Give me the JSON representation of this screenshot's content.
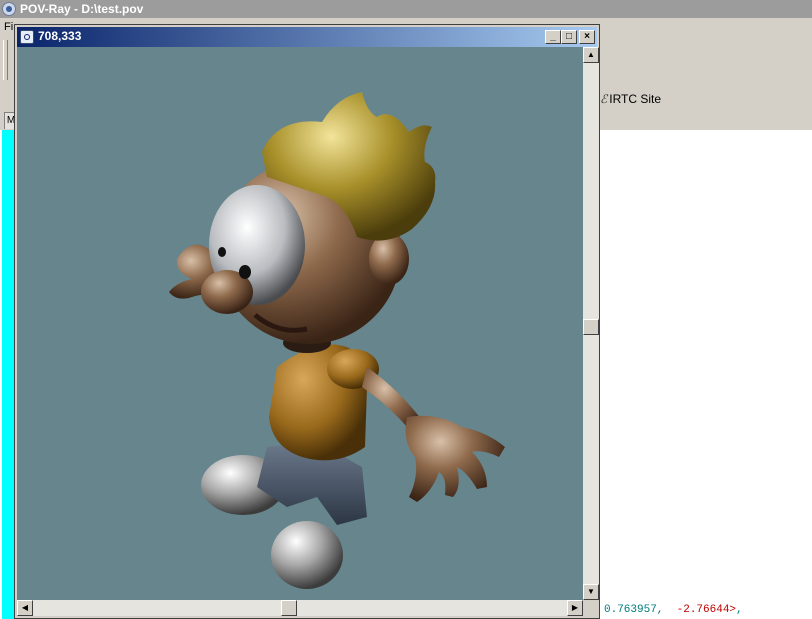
{
  "app": {
    "title": "POV-Ray - D:\\test.pov",
    "menu_partial": "Fi",
    "tab_partial": "M",
    "ribbon_link": "IRTC Site"
  },
  "render_window": {
    "title": "708,333",
    "minimize": "_",
    "maximize": "□",
    "close": "×"
  },
  "editor": {
    "line1": [
      "0.763957,",
      "-2.76644>",
      ","
    ]
  },
  "scrollbars": {
    "up": "▲",
    "down": "▼",
    "left": "◀",
    "right": "▶"
  },
  "colors": {
    "render_bg": "#66858d",
    "title_active_start": "#0a246a",
    "title_active_end": "#a6caf0",
    "editor_margin": "#00ffff"
  }
}
